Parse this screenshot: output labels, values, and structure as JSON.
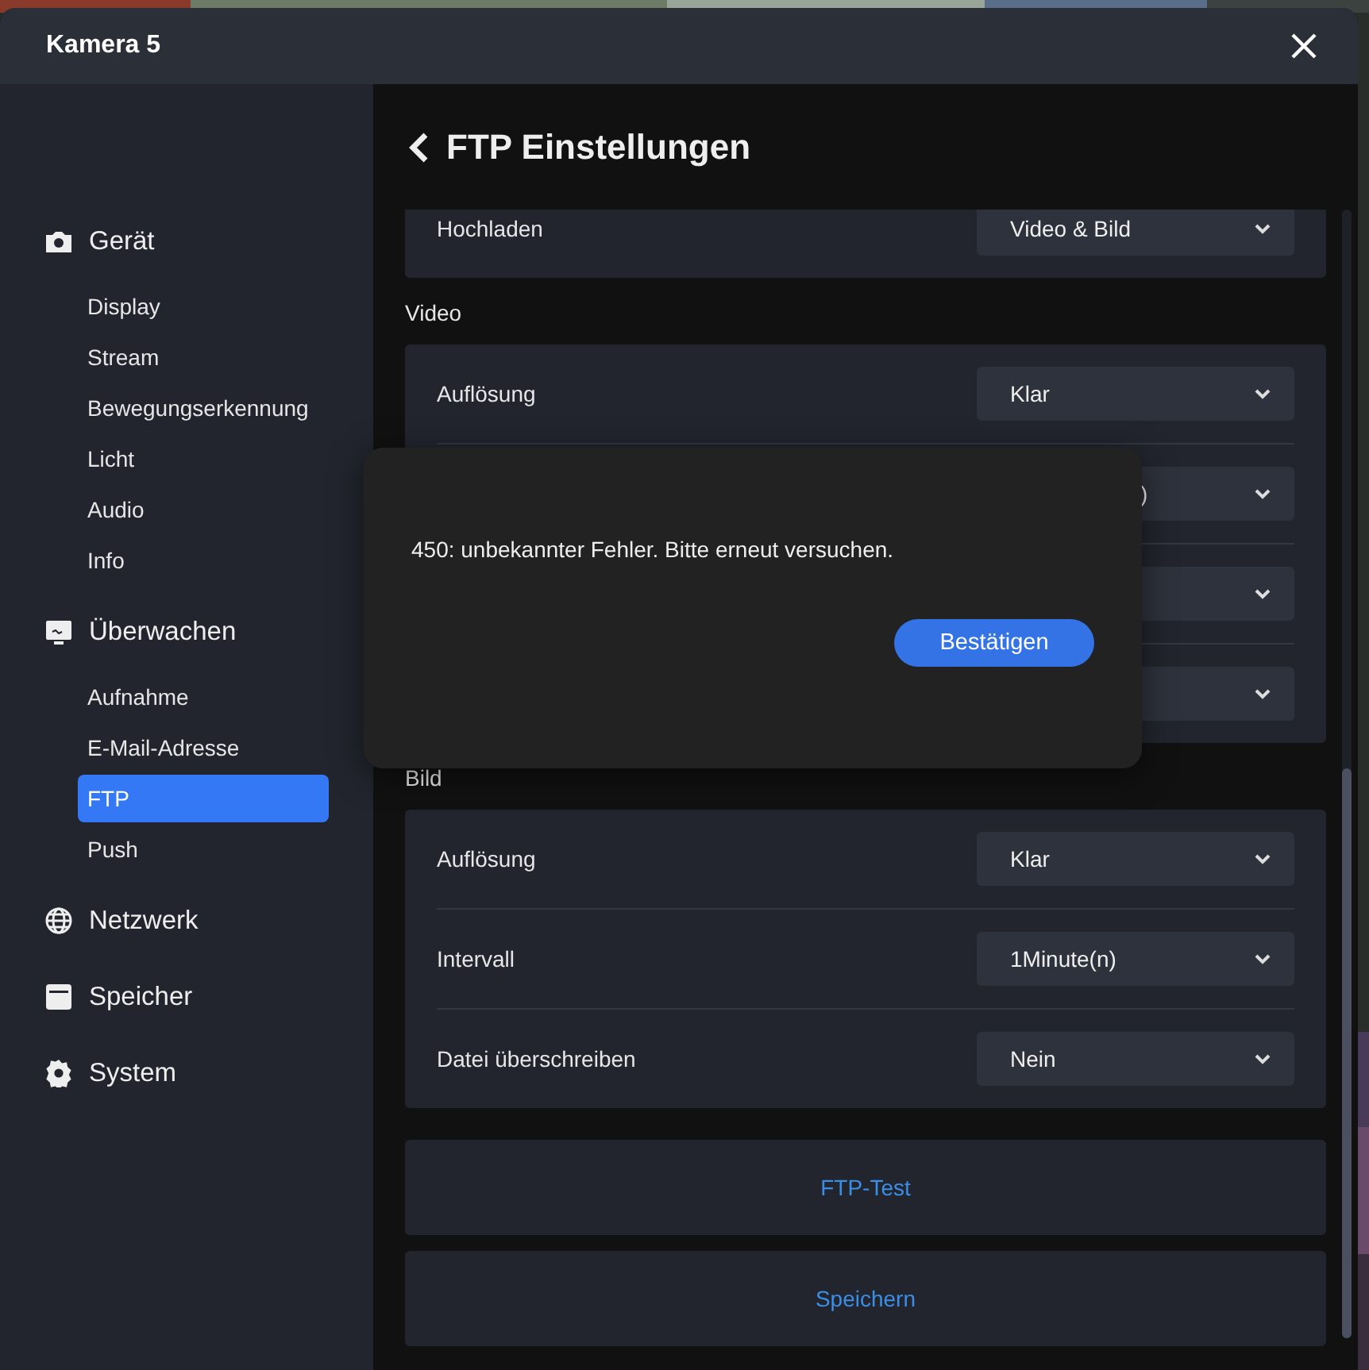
{
  "window": {
    "title": "Kamera 5"
  },
  "sidebar": {
    "groups": [
      {
        "label": "Gerät",
        "items": [
          {
            "label": "Display",
            "selected": false
          },
          {
            "label": "Stream",
            "selected": false
          },
          {
            "label": "Bewegungserkennung",
            "selected": false
          },
          {
            "label": "Licht",
            "selected": false
          },
          {
            "label": "Audio",
            "selected": false
          },
          {
            "label": "Info",
            "selected": false
          }
        ]
      },
      {
        "label": "Überwachen",
        "items": [
          {
            "label": "Aufnahme",
            "selected": false
          },
          {
            "label": "E-Mail-Adresse",
            "selected": false
          },
          {
            "label": "FTP",
            "selected": true
          },
          {
            "label": "Push",
            "selected": false
          }
        ]
      },
      {
        "label": "Netzwerk"
      },
      {
        "label": "Speicher"
      },
      {
        "label": "System"
      }
    ]
  },
  "page": {
    "title": "FTP Einstellungen",
    "sections": [
      {
        "rows": [
          {
            "label": "Hochladen",
            "value": "Video & Bild"
          }
        ]
      },
      {
        "heading": "Video",
        "rows": [
          {
            "label": "Auflösung",
            "value": "Klar"
          },
          {
            "value": ")",
            "clipped": true
          },
          {},
          {}
        ]
      },
      {
        "heading": "Bild",
        "rows": [
          {
            "label": "Auflösung",
            "value": "Klar"
          },
          {
            "label": "Intervall",
            "value": "1Minute(n)"
          },
          {
            "label": "Datei überschreiben",
            "value": "Nein"
          }
        ]
      }
    ],
    "actions": [
      "FTP-Test",
      "Speichern"
    ]
  },
  "dialog": {
    "message": "450: unbekannter Fehler. Bitte erneut versuchen.",
    "button": "Bestätigen"
  }
}
